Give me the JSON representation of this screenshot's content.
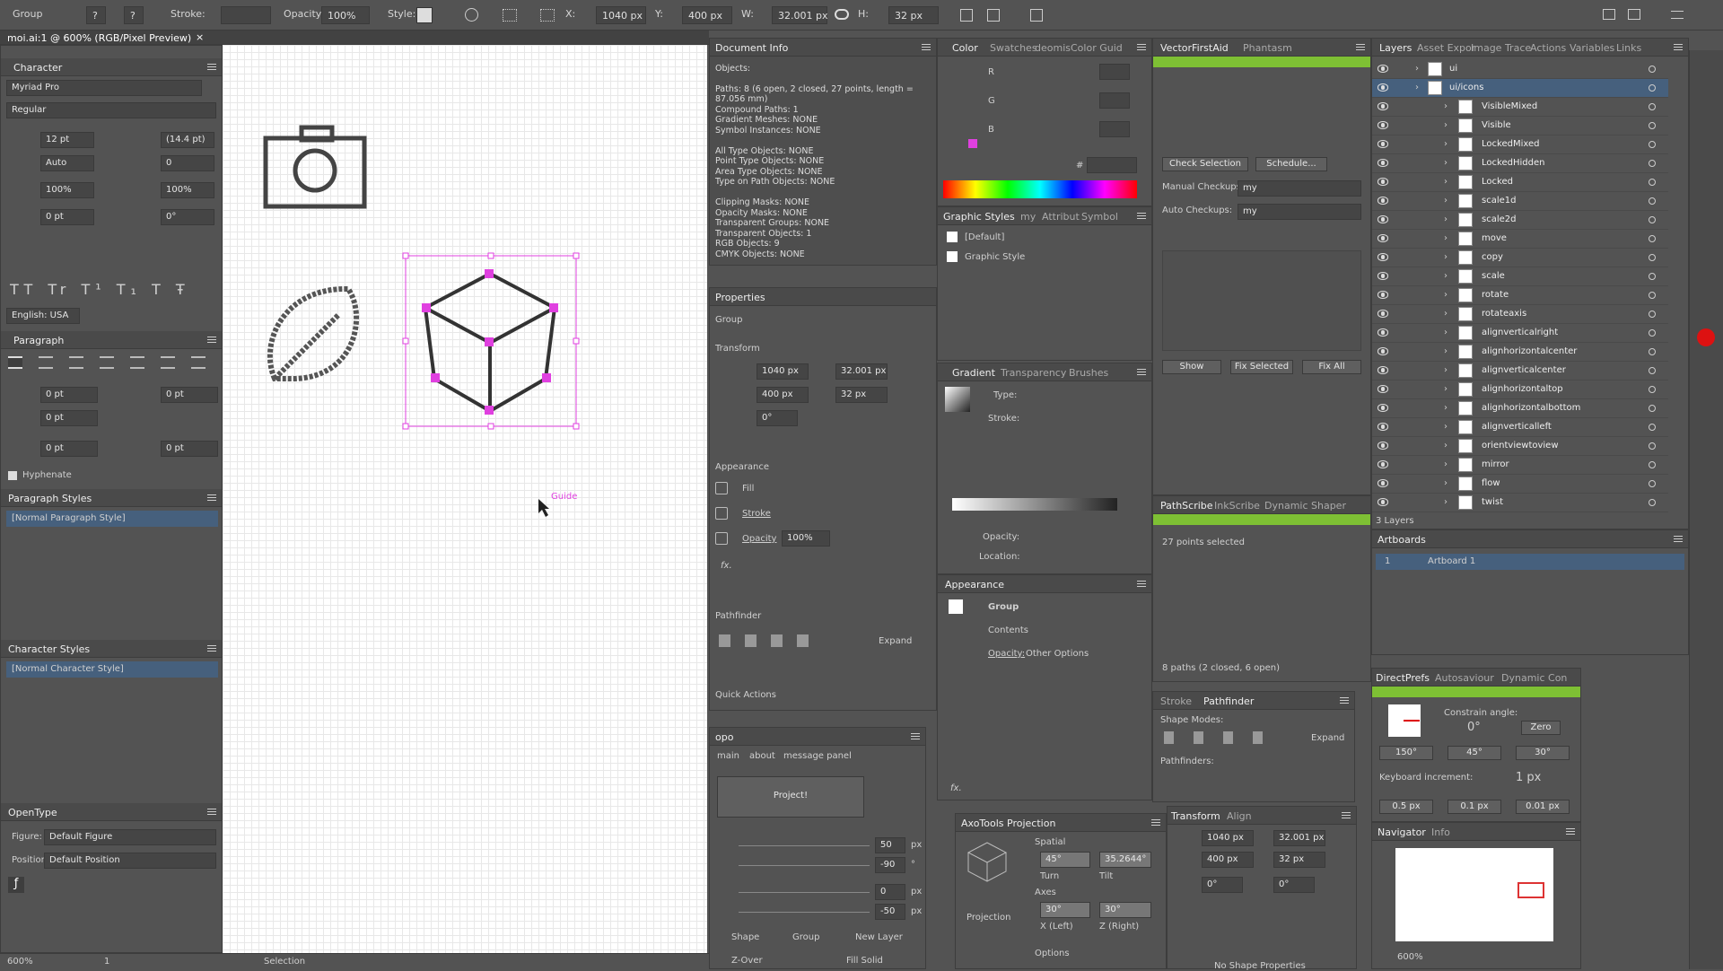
{
  "toolbar": {
    "group": "Group",
    "stroke": "Stroke:",
    "opacity_label": "Opacity:",
    "opacity": "100%",
    "style": "Style:",
    "x_label": "X:",
    "x": "1040 px",
    "y_label": "Y:",
    "y": "400 px",
    "w_label": "W:",
    "w": "32.001 px",
    "h_label": "H:",
    "h": "32 px"
  },
  "doc_tab": {
    "title": "moi.ai:1 @ 600% (RGB/Pixel Preview)",
    "close": "×"
  },
  "character": {
    "title": "Character",
    "font": "Myriad Pro",
    "style": "Regular",
    "size": "12 pt",
    "leading": "(14.4 pt)",
    "kerning": "Auto",
    "tracking": "0",
    "hscale": "100%",
    "vscale": "100%",
    "baseline": "0 pt",
    "rotation": "0°",
    "language": "English: USA"
  },
  "paragraph": {
    "title": "Paragraph",
    "left_indent": "0 pt",
    "right_indent": "0 pt",
    "first_line": "0 pt",
    "space_before": "0 pt",
    "space_after": "0 pt",
    "hyphenate": "Hyphenate"
  },
  "para_styles": {
    "title": "Paragraph Styles",
    "item": "[Normal Paragraph Style]"
  },
  "char_styles": {
    "title": "Character Styles",
    "item": "[Normal Character Style]"
  },
  "opentype": {
    "title": "OpenType",
    "figure_label": "Figure:",
    "figure": "Default Figure",
    "position_label": "Position:",
    "position": "Default Position"
  },
  "canvas": {
    "guide": "Guide"
  },
  "status": {
    "zoom": "600%",
    "page": "1",
    "tool": "Selection"
  },
  "doc_info": {
    "title": "Document Info",
    "lines": [
      "Objects:",
      "",
      "Paths: 8 (6 open, 2 closed, 27 points, length =",
      "87.056 mm)",
      "Compound Paths: 1",
      "Gradient Meshes: NONE",
      "Symbol Instances: NONE",
      "",
      "All Type Objects: NONE",
      "Point Type Objects: NONE",
      "Area Type Objects: NONE",
      "Type on Path Objects: NONE",
      "",
      "Clipping Masks: NONE",
      "Opacity Masks: NONE",
      "Transparent Groups: NONE",
      "Transparent Objects: 1",
      "RGB Objects: 9",
      "CMYK Objects: NONE"
    ]
  },
  "properties": {
    "title": "Properties",
    "group": "Group",
    "transform": "Transform",
    "x": "1040 px",
    "y": "400 px",
    "w": "32.001 px",
    "h": "32 px",
    "angle": "0°",
    "appearance": "Appearance",
    "fill": "Fill",
    "stroke": "Stroke",
    "opacity": "Opacity",
    "opacity_val": "100%",
    "fx": "fx.",
    "pathfinder": "Pathfinder",
    "expand": "Expand",
    "quick": "Quick Actions"
  },
  "opo": {
    "title": "opo",
    "tabs": [
      "main",
      "about",
      "message panel"
    ],
    "project": "Project!",
    "vals": [
      "50",
      "-90",
      "0",
      "-50"
    ],
    "units": [
      "px",
      "°",
      "px",
      "px"
    ],
    "radios": [
      "Shape",
      "Group",
      "New Layer"
    ],
    "zover": "Z-Over",
    "fillsolid": "Fill Solid"
  },
  "color": {
    "tabs": [
      "Color",
      "Swatches",
      "deomis",
      "Color Guid"
    ],
    "r": "R",
    "g": "G",
    "b": "B",
    "hash": "#"
  },
  "graphic_styles": {
    "tabs": [
      "Graphic Styles",
      "my",
      "Attribut",
      "Symbol"
    ],
    "items": [
      "[Default]",
      "Graphic Style"
    ]
  },
  "gradient": {
    "tabs": [
      "Gradient",
      "Transparency",
      "Brushes"
    ],
    "type": "Type:",
    "stroke": "Stroke:",
    "opacity": "Opacity:",
    "location": "Location:"
  },
  "appearance_panel": {
    "title": "Appearance",
    "group": "Group",
    "contents": "Contents",
    "opacity": "Opacity:",
    "opacity_val": "Other Options"
  },
  "vfa": {
    "tabs": [
      "VectorFirstAid",
      "Phantasm"
    ],
    "check": "Check Selection",
    "schedule": "Schedule...",
    "manual": "Manual Checkups:",
    "manual_val": "my",
    "auto": "Auto Checkups:",
    "auto_val": "my",
    "show": "Show",
    "fix_sel": "Fix Selected",
    "fix_all": "Fix All"
  },
  "pathscribe": {
    "tabs": [
      "PathScribe",
      "InkScribe",
      "Dynamic Shaper"
    ],
    "selected": "27 points selected",
    "paths": "8 paths (2 closed, 6 open)"
  },
  "stroke_pf": {
    "tabs": [
      "Stroke",
      "Pathfinder"
    ],
    "shape_modes": "Shape Modes:",
    "expand": "Expand",
    "pathfinders": "Pathfinders:"
  },
  "axo": {
    "title": "AxoTools Projection",
    "spatial": "Spatial",
    "turn": "45°",
    "tilt": "35.2644°",
    "turn_l": "Turn",
    "tilt_l": "Tilt",
    "axes": "Axes",
    "xl": "30°",
    "zr": "30°",
    "xl_l": "X (Left)",
    "zr_l": "Z (Right)",
    "projection": "Projection",
    "options": "Options"
  },
  "transform2": {
    "tabs": [
      "Transform",
      "Align"
    ],
    "x": "1040 px",
    "y": "400 px",
    "w": "32.001 px",
    "h": "32 px",
    "angle": "0°",
    "shear": "0°",
    "noshape": "No Shape Properties"
  },
  "layers": {
    "tabs": [
      "Layers",
      "Asset Expor",
      "Image Trace",
      "Actions",
      "Variables",
      "Links"
    ],
    "top": [
      "ui",
      "ui/icons"
    ],
    "items": [
      "VisibleMixed",
      "Visible",
      "LockedMixed",
      "LockedHidden",
      "Locked",
      "scale1d",
      "scale2d",
      "move",
      "copy",
      "scale",
      "rotate",
      "rotateaxis",
      "alignverticalright",
      "alignhorizontalcenter",
      "alignverticalcenter",
      "alignhorizontaltop",
      "alignhorizontalbottom",
      "alignverticalleft",
      "orientviewtoview",
      "mirror",
      "flow",
      "twist"
    ],
    "count": "3 Layers"
  },
  "artboards": {
    "title": "Artboards",
    "num": "1",
    "name": "Artboard 1"
  },
  "directprefs": {
    "tabs": [
      "DirectPrefs",
      "Autosaviour",
      "Dynamic Con"
    ],
    "constrain": "Constrain angle:",
    "angle": "0°",
    "zero": "Zero",
    "a1": "150°",
    "a2": "45°",
    "a3": "30°",
    "kb": "Keyboard increment:",
    "kbval": "1 px",
    "k1": "0.5 px",
    "k2": "0.1 px",
    "k3": "0.01 px"
  },
  "navigator": {
    "tabs": [
      "Navigator",
      "Info"
    ],
    "zoom": "600%"
  },
  "colors": {
    "accent": "#e040e0",
    "green": "#7ec034",
    "select": "#46607d"
  }
}
